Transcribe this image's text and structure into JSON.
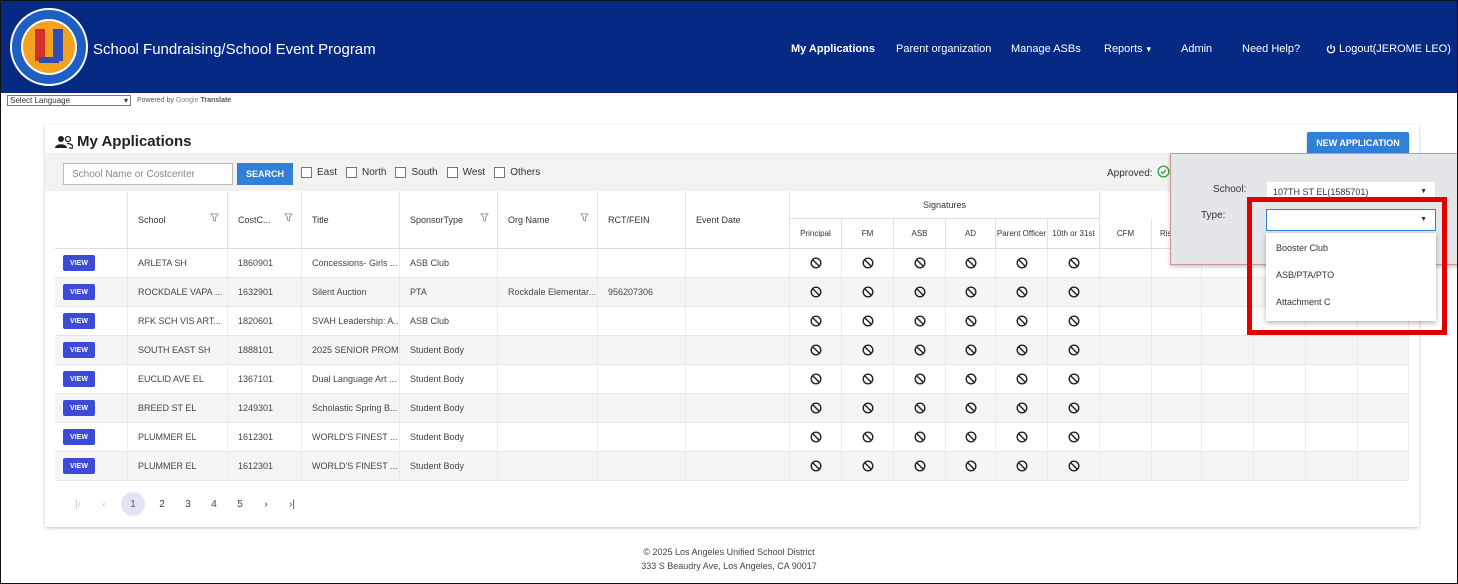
{
  "header": {
    "title": "School Fundraising/School Event Program",
    "nav": [
      {
        "label": "My Applications"
      },
      {
        "label": "Parent organization"
      },
      {
        "label": "Manage ASBs"
      },
      {
        "label": "Reports"
      },
      {
        "label": "Admin"
      },
      {
        "label": "Need Help?"
      },
      {
        "label": "Logout(JEROME LEO)"
      }
    ],
    "brand_color": "#062a83"
  },
  "language_bar": {
    "select_value": "Select Language",
    "powered_by": "Powered by",
    "google": "Google",
    "translate": "Translate"
  },
  "main": {
    "title": "My Applications",
    "new_application_label": "NEW APPLICATION",
    "search": {
      "placeholder": "School Name or Costcenter",
      "button": "SEARCH"
    },
    "filters": [
      "East",
      "North",
      "South",
      "West",
      "Others"
    ],
    "approved_label": "Approved:",
    "table": {
      "columns": [
        "School",
        "CostC...",
        "Title",
        "SponsorType",
        "Org Name",
        "RCT/FEIN",
        "Event Date"
      ],
      "signatures_label": "Signatures",
      "signature_columns": [
        "Principal",
        "FM",
        "ASB",
        "AD",
        "Parent Officer",
        "10th or 31st"
      ],
      "extra_columns": [
        "CFM",
        "Risk"
      ],
      "view_label": "VIEW",
      "rows": [
        {
          "school": "ARLETA SH",
          "cost": "1860901",
          "title": "Concessions- Girls ...",
          "sponsor": "ASB Club",
          "org": "",
          "fein": ""
        },
        {
          "school": "ROCKDALE VAPA ...",
          "cost": "1632901",
          "title": "Silent Auction",
          "sponsor": "PTA",
          "org": "Rockdale Elementar...",
          "fein": "956207306"
        },
        {
          "school": "RFK SCH VIS ART...",
          "cost": "1820601",
          "title": "SVAH Leadership: A...",
          "sponsor": "ASB Club",
          "org": "",
          "fein": ""
        },
        {
          "school": "SOUTH EAST SH",
          "cost": "1888101",
          "title": "2025 SENIOR PROM",
          "sponsor": "Student Body",
          "org": "",
          "fein": ""
        },
        {
          "school": "EUCLID AVE EL",
          "cost": "1367101",
          "title": "Dual Language Art ...",
          "sponsor": "Student Body",
          "org": "",
          "fein": ""
        },
        {
          "school": "BREED ST EL",
          "cost": "1249301",
          "title": "Scholastic Spring B...",
          "sponsor": "Student Body",
          "org": "",
          "fein": ""
        },
        {
          "school": "PLUMMER EL",
          "cost": "1612301",
          "title": "WORLD'S FINEST ...",
          "sponsor": "Student Body",
          "org": "",
          "fein": ""
        },
        {
          "school": "PLUMMER EL",
          "cost": "1612301",
          "title": "WORLD'S FINEST ...",
          "sponsor": "Student Body",
          "org": "",
          "fein": ""
        }
      ]
    },
    "pagination": {
      "pages": [
        "1",
        "2",
        "3",
        "4",
        "5"
      ],
      "current": "1"
    }
  },
  "popover": {
    "school_label": "School:",
    "school_value": "107TH ST EL(1585701)",
    "type_label": "Type:",
    "type_value": "",
    "type_options": [
      "Booster Club",
      "ASB/PTA/PTO",
      "Attachment C"
    ]
  },
  "footer": {
    "copyright": "© 2025 Los Angeles Unified School District",
    "address": "333 S Beaudry Ave, Los Angeles, CA 90017"
  },
  "colors": {
    "accent": "#2f80d6",
    "view_button": "#3d4ad8",
    "highlight": "#e00000",
    "approved_icon": "#2e9e44"
  },
  "icons": {
    "logo": "district-seal-logo",
    "users": "users-icon",
    "filter": "filter-icon",
    "blocked": "block-icon",
    "power": "power-icon",
    "check": "check-circle-icon"
  }
}
